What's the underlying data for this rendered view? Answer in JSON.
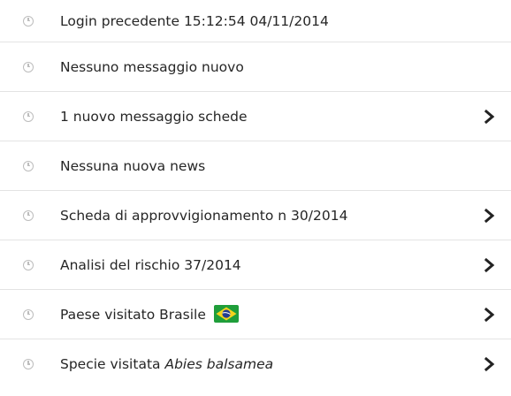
{
  "activity": {
    "items": [
      {
        "label": "Login precedente 15:12:54 04/11/2014",
        "has_chevron": false
      },
      {
        "label": "Nessuno messaggio nuovo",
        "has_chevron": false
      },
      {
        "label": "1 nuovo messaggio schede",
        "has_chevron": true
      },
      {
        "label": "Nessuna nuova news",
        "has_chevron": false
      },
      {
        "label": "Scheda di approvvigionamento n 30/2014",
        "has_chevron": true
      },
      {
        "label": "Analisi del rischio 37/2014",
        "has_chevron": true
      },
      {
        "label": "Paese visitato Brasile",
        "flag_icon": "brazil-flag-icon",
        "has_chevron": true
      },
      {
        "label_prefix": "Specie visitata",
        "label_species": "Abies balsamea",
        "has_chevron": true
      }
    ],
    "icons": {
      "row_icon": "clock-icon",
      "chevron": "chevron-right-icon"
    },
    "colors": {
      "divider": "#e3e3e3",
      "clock_icon": "#bdbdbd",
      "text": "#262626",
      "chevron": "#222222",
      "flag_green": "#1f9e3a",
      "flag_yellow": "#f5d31c",
      "flag_blue": "#233c8f"
    }
  }
}
